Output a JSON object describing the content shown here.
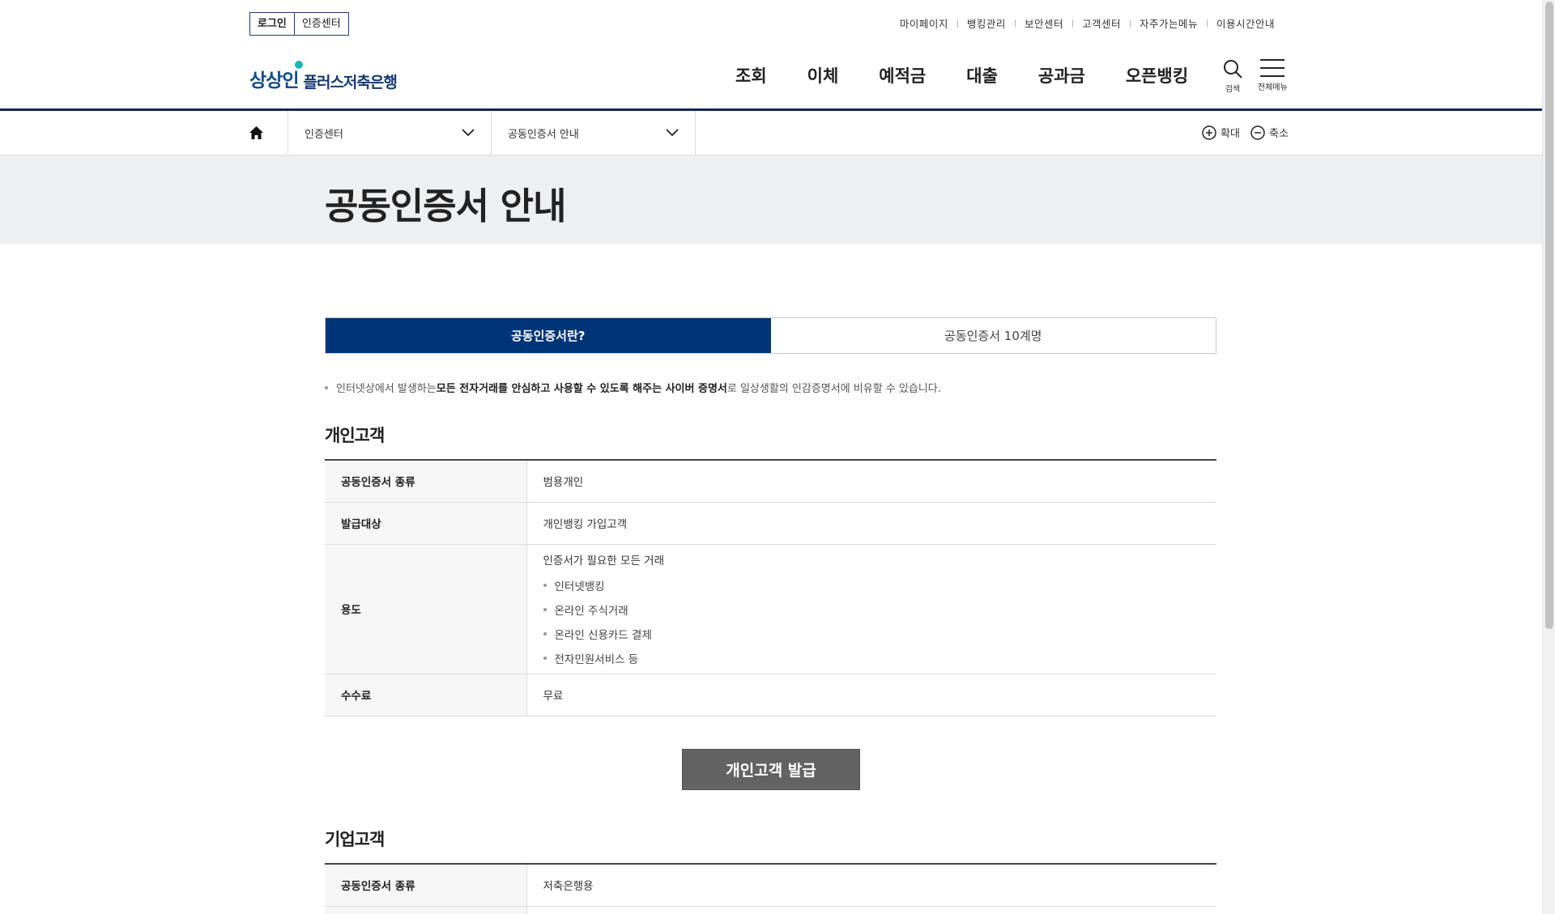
{
  "utility": {
    "login": "로그인",
    "cert_center": "인증센터",
    "links": [
      "마이페이지",
      "뱅킹관리",
      "보안센터",
      "고객센터",
      "자주가는메뉴",
      "이용시간안내"
    ]
  },
  "logo": {
    "mark": "상상인",
    "text": "플러스저축은행"
  },
  "gnb": [
    "조회",
    "이체",
    "예적금",
    "대출",
    "공과금",
    "오픈뱅킹"
  ],
  "tools": {
    "search": "검색",
    "menu": "전체메뉴"
  },
  "location": {
    "depth1": "인증센터",
    "depth2": "공동인증서 안내",
    "zoom_in": "확대",
    "zoom_out": "축소"
  },
  "page_title": "공동인증서 안내",
  "tabs": [
    "공동인증서란?",
    "공동인증서 10계명"
  ],
  "intro": {
    "before": "인터넷상에서 발생하는 ",
    "bold": "모든 전자거래를 안심하고 사용할 수 있도록 해주는 사이버 증명서",
    "after": "로 일상생활의 인감증명서에 비유할 수 있습니다."
  },
  "personal": {
    "title": "개인고객",
    "rows": [
      {
        "label": "공동인증서 종류",
        "value": "범용개인"
      },
      {
        "label": "발급대상",
        "value": "개인뱅킹 가입고객"
      },
      {
        "label": "용도",
        "value": "인증서가 필요한 모든 거래",
        "items": [
          "인터넷뱅킹",
          "온라인 주식거래",
          "온라인 신용카드 결제",
          "전자민원서비스 등"
        ]
      },
      {
        "label": "수수료",
        "value": "무료"
      }
    ],
    "button": "개인고객 발급"
  },
  "corporate": {
    "title": "기업고객",
    "rows": [
      {
        "label": "공동인증서 종류",
        "value": "저축은행용"
      }
    ]
  }
}
